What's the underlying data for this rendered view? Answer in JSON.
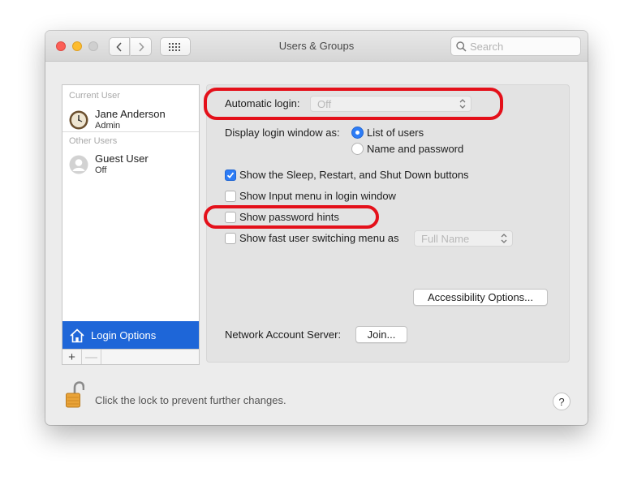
{
  "window": {
    "title": "Users & Groups",
    "search_placeholder": "Search"
  },
  "sidebar": {
    "current_user_label": "Current User",
    "current_user": {
      "name": "Jane Anderson",
      "role": "Admin"
    },
    "other_users_label": "Other Users",
    "other_users": [
      {
        "name": "Guest User",
        "status": "Off"
      }
    ],
    "login_options_label": "Login Options",
    "add_label": "+",
    "remove_label": "—"
  },
  "panel": {
    "automatic_login_label": "Automatic login:",
    "automatic_login_value": "Off",
    "display_login_label": "Display login window as:",
    "radio_options": [
      {
        "label": "List of users",
        "selected": true
      },
      {
        "label": "Name and password",
        "selected": false
      }
    ],
    "checkboxes": [
      {
        "label": "Show the Sleep, Restart, and Shut Down buttons",
        "checked": true
      },
      {
        "label": "Show Input menu in login window",
        "checked": false
      },
      {
        "label": "Show password hints",
        "checked": false
      },
      {
        "label": "Show fast user switching menu as",
        "checked": false
      }
    ],
    "fast_switch_value": "Full Name",
    "accessibility_button": "Accessibility Options...",
    "network_server_label": "Network Account Server:",
    "join_button": "Join..."
  },
  "footer": {
    "lock_text": "Click the lock to prevent further changes.",
    "help_label": "?"
  },
  "colors": {
    "selection_blue": "#1e66d8",
    "highlight_red": "#e4101a",
    "checkbox_blue": "#2d7cf6"
  }
}
